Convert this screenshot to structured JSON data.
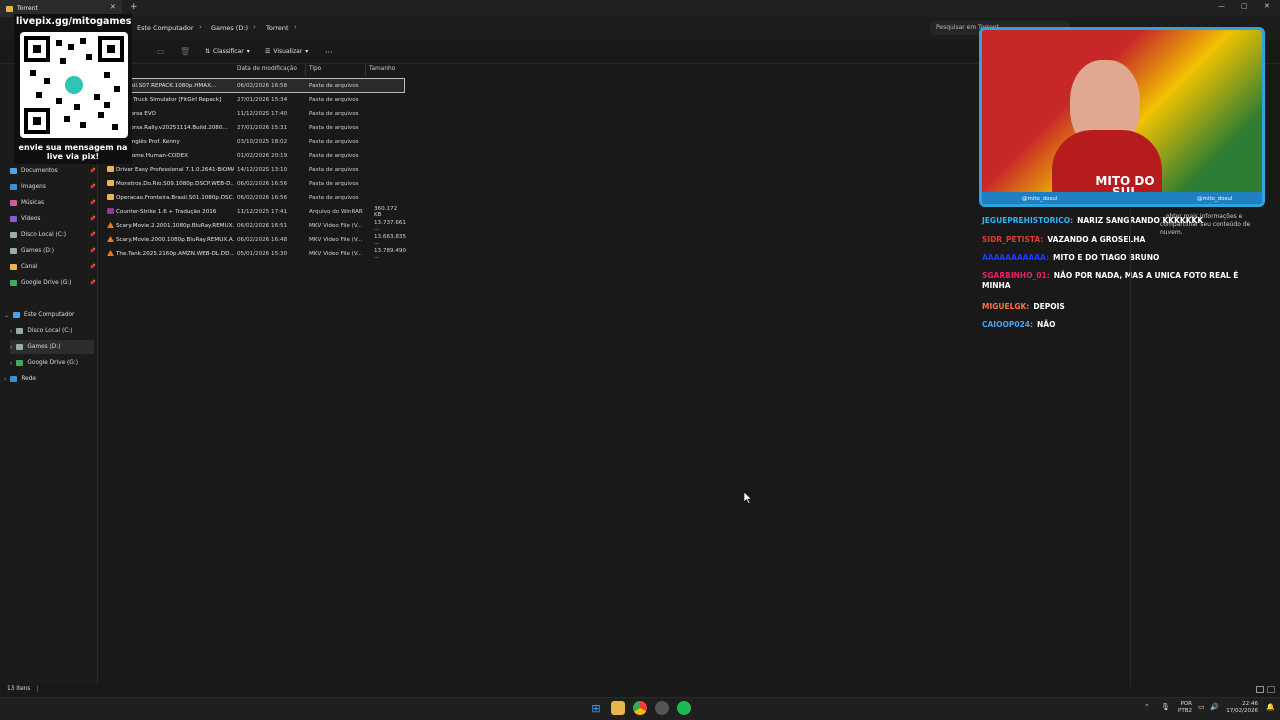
{
  "window": {
    "tab_title": "Torrent",
    "new_tab": "+",
    "minimize": "—",
    "maximize": "▢",
    "close": "✕"
  },
  "breadcrumb": [
    "Este Computador",
    "Games (D:)",
    "Torrent"
  ],
  "search": {
    "placeholder": "Pesquisar em Torrent"
  },
  "toolbar": {
    "sort_label": "Classificar",
    "view_label": "Visualizar",
    "more_label": "···"
  },
  "columns": {
    "date": "Data de modificação",
    "type": "Tipo",
    "size": "Tamanho"
  },
  "files": [
    {
      "name": "...Brasil.S07.REPACK.1080p.HMAX...",
      "date": "06/02/2026 16:58",
      "type": "Pasta de arquivos",
      "size": "",
      "kind": "folder",
      "selected": true
    },
    {
      "name": "...can Truck Simulator [FitGirl Repack]",
      "date": "27/01/2026 15:34",
      "type": "Pasta de arquivos",
      "size": "",
      "kind": "folder"
    },
    {
      "name": "...o Corsa EVO",
      "date": "11/12/2025 17:40",
      "type": "Pasta de arquivos",
      "size": "",
      "kind": "folder"
    },
    {
      "name": "...o.Corsa.Rally.v20251114.Build.2080...",
      "date": "27/01/2026 15:31",
      "type": "Pasta de arquivos",
      "size": "",
      "kind": "folder"
    },
    {
      "name": "...de Inglês Prof. Kenny",
      "date": "03/10/2025 18:02",
      "type": "Pasta de arquivos",
      "size": "",
      "kind": "folder"
    },
    {
      "name": "...Become.Human-CODEX",
      "date": "01/02/2026 20:19",
      "type": "Pasta de arquivos",
      "size": "",
      "kind": "folder"
    },
    {
      "name": "Driver Easy Professional 7.1.0.2641-BiOMA",
      "date": "14/12/2025 13:10",
      "type": "Pasta de arquivos",
      "size": "",
      "kind": "folder"
    },
    {
      "name": "Monstros.Do.Rio.S09.1080p.DSCP.WEB-D...",
      "date": "06/02/2026 16:56",
      "type": "Pasta de arquivos",
      "size": "",
      "kind": "folder"
    },
    {
      "name": "Operacao.Fronteira.Brasil.S01.1080p.DSC...",
      "date": "06/02/2026 16:56",
      "type": "Pasta de arquivos",
      "size": "",
      "kind": "folder"
    },
    {
      "name": "Counter-Strike 1.6 + Tradução 2016",
      "date": "11/12/2025 17:41",
      "type": "Arquivo do WinRAR",
      "size": "360.172 KB",
      "kind": "rar"
    },
    {
      "name": "Scary.Movie.2.2001.1080p.BluRay.REMUX...",
      "date": "06/02/2026 16:51",
      "type": "MKV Video File (V...",
      "size": "13.737.661 ...",
      "kind": "mkv"
    },
    {
      "name": "Scary.Movie.2000.1080p.BluRay.REMUX.A...",
      "date": "06/02/2026 16:48",
      "type": "MKV Video File (V...",
      "size": "13.663.835 ...",
      "kind": "mkv"
    },
    {
      "name": "The.Tank.2025.2160p.AMZN.WEB-DL.DD...",
      "date": "05/01/2026 15:30",
      "type": "MKV Video File (V...",
      "size": "13.789.490 ...",
      "kind": "mkv"
    }
  ],
  "nav_quick": [
    {
      "label": "Documentos",
      "icon": "documents-icon",
      "color": "#5aa0e6"
    },
    {
      "label": "Imagens",
      "icon": "images-icon",
      "color": "#3d8fd6"
    },
    {
      "label": "Músicas",
      "icon": "music-icon",
      "color": "#d05a9a"
    },
    {
      "label": "Vídeos",
      "icon": "videos-icon",
      "color": "#8a5ad0"
    },
    {
      "label": "Disco Local (C:)",
      "icon": "drive-icon",
      "color": "#9aa"
    },
    {
      "label": "Games (D:)",
      "icon": "drive-icon",
      "color": "#9aa"
    },
    {
      "label": "Canal",
      "icon": "folder-icon",
      "color": "#e8b54a"
    },
    {
      "label": "Google Drive (G:)",
      "icon": "google-drive-icon",
      "color": "#3fae5a"
    }
  ],
  "nav_tree": [
    {
      "label": "Este Computador",
      "icon": "computer-icon",
      "expanded": true
    },
    {
      "label": "Disco Local (C:)",
      "icon": "drive-icon"
    },
    {
      "label": "Games (D:)",
      "icon": "drive-icon",
      "selected": true
    },
    {
      "label": "Google Drive (G:)",
      "icon": "google-drive-icon"
    },
    {
      "label": "Rede",
      "icon": "network-icon"
    }
  ],
  "status": {
    "items_count": "13 itens"
  },
  "overlay": {
    "qr_title": "livepix.gg/mitogames",
    "qr_subtitle": "envie sua mensagem na live via pix!",
    "cam_brand": "MITO DO SUL",
    "cam_handle_ig": "@mito_dosul",
    "cam_handle_tt": "@mito_dosul"
  },
  "tooltip": "...obter mais informações e compartilhar seu conteúdo de nuvem.",
  "chat": [
    {
      "user": "JEGUEPREHISTORICO:",
      "user_color": "#29b6f6",
      "msg": "NARIZ SANGRANDO KKKKKKK"
    },
    {
      "user": "SIDR_PETISTA:",
      "user_color": "#e53935",
      "msg": "VAZANDO A GROSELHA"
    },
    {
      "user": "AAAAAAAAAAA:",
      "user_color": "#1e3cff",
      "msg": "MITO E DO TIAGO BRUNO"
    },
    {
      "user": "SGARBINHO_01:",
      "user_color": "#e91e63",
      "msg": "NÃO POR NADA, MAS A UNICA FOTO REAL É MINHA"
    },
    {
      "user": "MIGUELGK:",
      "user_color": "#ff7043",
      "msg": "DEPOIS"
    },
    {
      "user": "CAIOOP024:",
      "user_color": "#42a5f5",
      "msg": "NÃO"
    }
  ],
  "tray": {
    "lang": "POR",
    "layout": "PTB2",
    "time": "22:46",
    "date": "17/02/2026"
  }
}
